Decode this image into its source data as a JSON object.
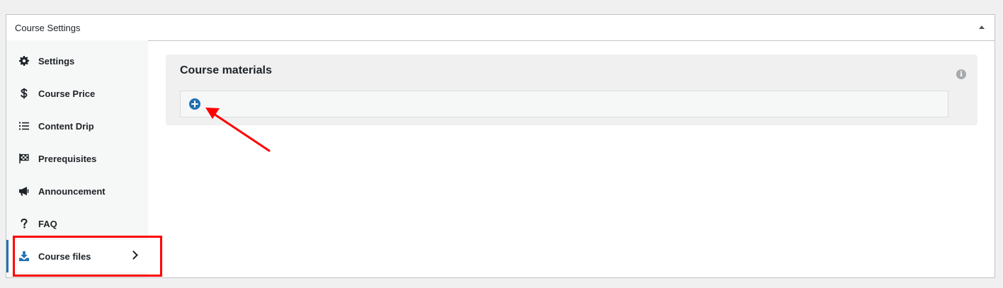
{
  "panel": {
    "title": "Course Settings"
  },
  "sidebar": {
    "items": [
      {
        "label": "Settings",
        "icon": "gear-icon"
      },
      {
        "label": "Course Price",
        "icon": "dollar-icon"
      },
      {
        "label": "Content Drip",
        "icon": "list-icon"
      },
      {
        "label": "Prerequisites",
        "icon": "checkered-flag-icon"
      },
      {
        "label": "Announcement",
        "icon": "megaphone-icon"
      },
      {
        "label": "FAQ",
        "icon": "question-icon"
      },
      {
        "label": "Course files",
        "icon": "download-icon",
        "active": true
      }
    ]
  },
  "main": {
    "section_title": "Course materials"
  },
  "colors": {
    "accent": "#2271b1",
    "annotation": "#ff0000"
  }
}
